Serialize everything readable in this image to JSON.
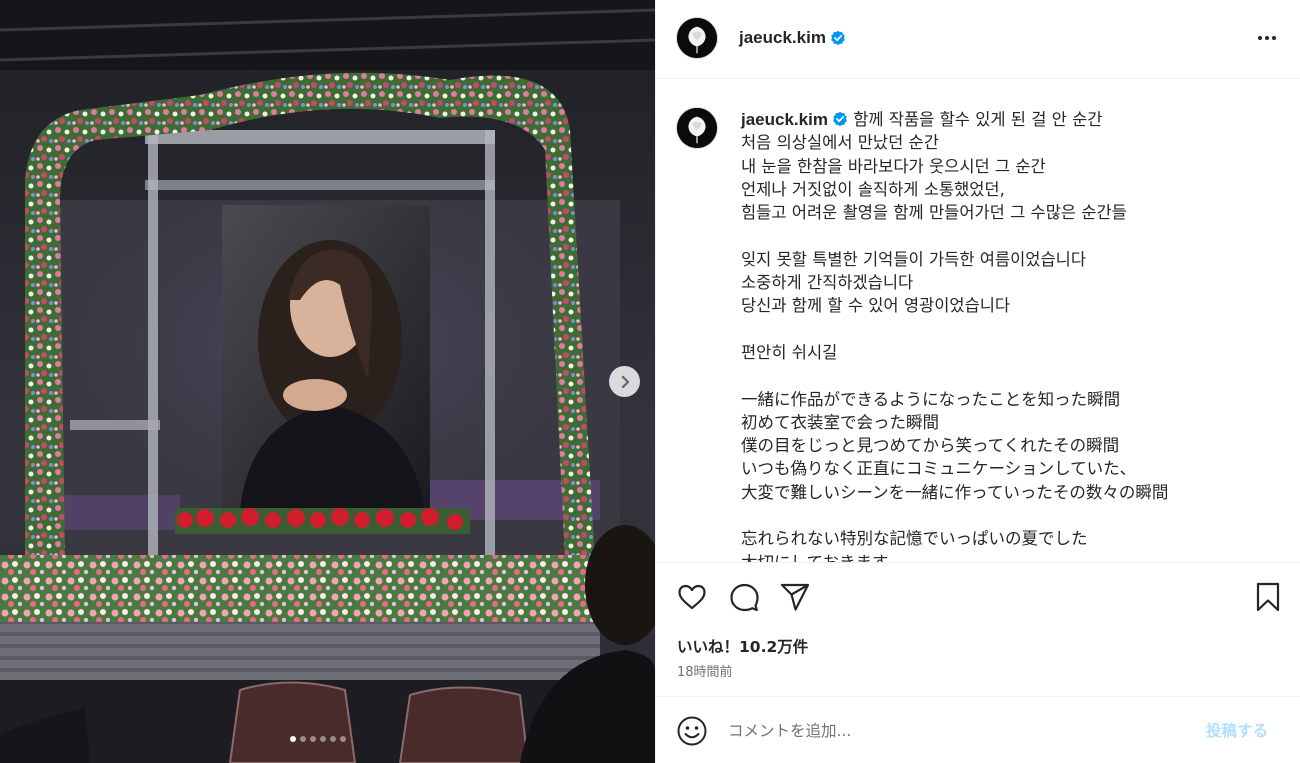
{
  "post": {
    "username": "jaeuck.kim",
    "verified": true,
    "caption_lines": [
      "함께 작품을 할수 있게 된 걸 안 순간",
      "처음 의상실에서 만났던 순간",
      "내 눈을 한참을 바라보다가 웃으시던 그 순간",
      "언제나 거짓없이 솔직하게 소통했었던,",
      "힘들고 어려운 촬영을 함께 만들어가던 그 수많은 순간들",
      "",
      "잊지 못할 특별한 기억들이 가득한 여름이었습니다",
      "소중하게 간직하겠습니다",
      "당신과 함께 할 수 있어 영광이었습니다",
      "",
      "편안히 쉬시길",
      "",
      "一緒に作品ができるようになったことを知った瞬間",
      "初めて衣装室で会った瞬間",
      "僕の目をじっと見つめてから笑ってくれたその瞬間",
      "いつも偽りなく正直にコミュニケーションしていた、",
      "大変で難しいシーンを一緒に作っていったその数々の瞬間",
      "",
      "忘れられない特別な記憶でいっぱいの夏でした",
      "大切にしておきます"
    ],
    "likes_label": "いいね！10.2万件",
    "time_label": "18時間前"
  },
  "carousel": {
    "total_slides": 6,
    "current_index": 0
  },
  "comment": {
    "placeholder": "コメントを追加...",
    "post_label": "投稿する"
  },
  "icons": {
    "verified": "verified-badge-icon",
    "more": "more-options-icon",
    "like": "heart-icon",
    "comment": "comment-bubble-icon",
    "share": "paper-plane-icon",
    "save": "bookmark-icon",
    "emoji": "emoji-smile-icon",
    "next": "chevron-right-icon"
  },
  "colors": {
    "verified_blue": "#0095f6",
    "post_button_disabled": "#b2dffc",
    "secondary_text": "#737373",
    "divider": "#efefef"
  }
}
